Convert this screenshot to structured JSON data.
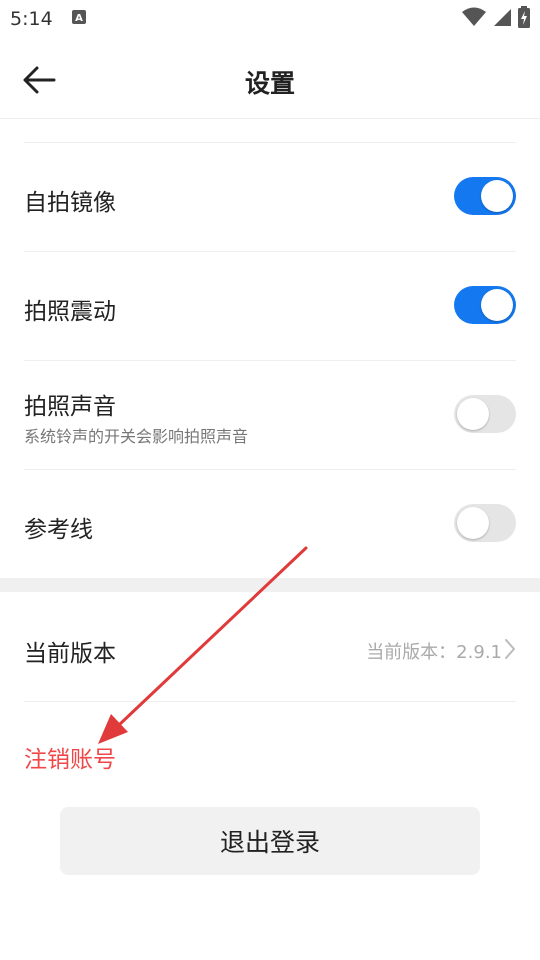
{
  "status_bar": {
    "time": "5:14",
    "icons": [
      "keyboard-a-icon",
      "wifi-icon",
      "signal-icon",
      "battery-charging-icon"
    ]
  },
  "app_bar": {
    "title": "设置",
    "back_icon": "arrow-left-icon"
  },
  "settings": {
    "selfie_mirror": {
      "label": "自拍镜像",
      "enabled": true
    },
    "shutter_vibration": {
      "label": "拍照震动",
      "enabled": true
    },
    "shutter_sound": {
      "label": "拍照声音",
      "subtitle": "系统铃声的开关会影响拍照声音",
      "enabled": false
    },
    "grid_lines": {
      "label": "参考线",
      "enabled": false
    }
  },
  "version": {
    "label": "当前版本",
    "value": "当前版本：2.9.1"
  },
  "delete_account_label": "注销账号",
  "logout_label": "退出登录",
  "colors": {
    "accent": "#1479f0",
    "danger": "#f04848",
    "annotation": "#e03a3a"
  }
}
